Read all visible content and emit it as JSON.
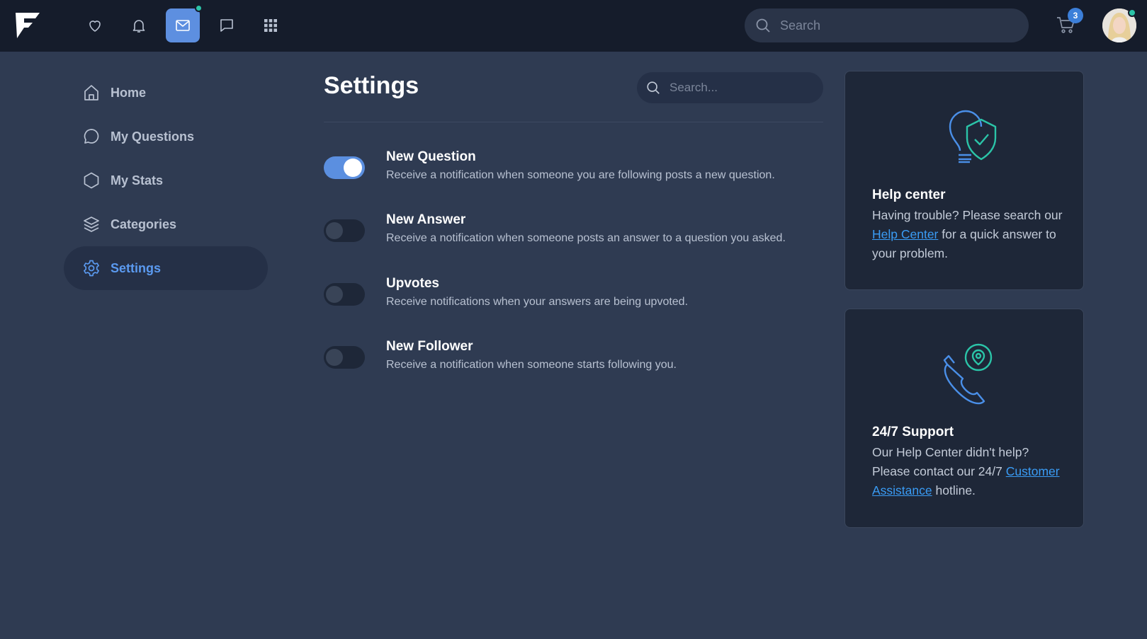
{
  "topbar": {
    "search_placeholder": "Search",
    "cart_count": "3",
    "nav_icons": [
      "heart-icon",
      "bell-icon",
      "mail-icon",
      "chat-icon",
      "grid-icon"
    ],
    "active_nav": "mail-icon",
    "accent_color": "#5d8fe0",
    "status_dot_color": "#2bc4a8"
  },
  "sidebar": {
    "items": [
      {
        "label": "Home",
        "icon": "home-icon"
      },
      {
        "label": "My Questions",
        "icon": "speech-bubble-icon"
      },
      {
        "label": "My Stats",
        "icon": "hexagon-icon"
      },
      {
        "label": "Categories",
        "icon": "layers-icon"
      },
      {
        "label": "Settings",
        "icon": "gear-icon",
        "active": true
      }
    ]
  },
  "main": {
    "title": "Settings",
    "search_placeholder": "Search...",
    "settings": [
      {
        "title": "New Question",
        "description": "Receive a notification when someone you are following posts a new question.",
        "enabled": true
      },
      {
        "title": "New Answer",
        "description": "Receive a notification when someone posts an answer to a question you asked.",
        "enabled": false
      },
      {
        "title": "Upvotes",
        "description": "Receive notifications when your answers are being upvoted.",
        "enabled": false
      },
      {
        "title": "New Follower",
        "description": "Receive a notification when someone starts following you.",
        "enabled": false
      }
    ]
  },
  "help_card": {
    "title": "Help center",
    "text_before": "Having trouble? Please search our ",
    "link": "Help Center",
    "text_after": " for a quick answer to your problem."
  },
  "support_card": {
    "title": "24/7 Support",
    "text_before": "Our Help Center didn't help? Please contact our 24/7 ",
    "link": "Customer Assistance",
    "text_after": " hotline."
  }
}
